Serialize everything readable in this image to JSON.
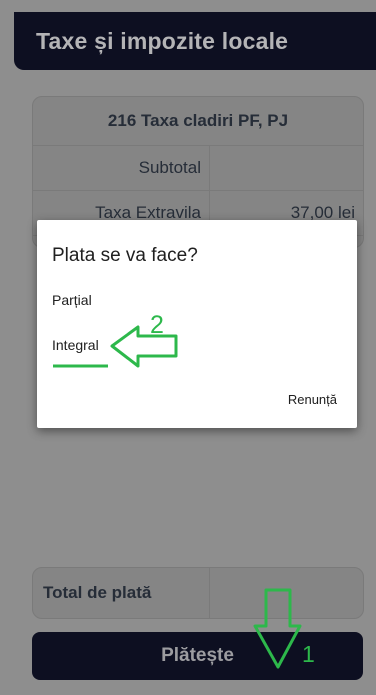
{
  "header": {
    "title": "Taxe și impozite locale"
  },
  "card": {
    "title": "216 Taxa cladiri PF, PJ",
    "rows": [
      {
        "label": "Subtotal",
        "value": ""
      },
      {
        "label": "Taxa Extravila",
        "value": "37,00 lei"
      }
    ]
  },
  "total": {
    "label": "Total de plată",
    "value": ""
  },
  "pay_button": {
    "label": "Plătește"
  },
  "dialog": {
    "title": "Plata se va face?",
    "options": [
      "Parțial",
      "Integral"
    ],
    "cancel": "Renunță"
  },
  "annotations": {
    "step_1": "1",
    "step_2": "2",
    "color": "#2db84b"
  }
}
